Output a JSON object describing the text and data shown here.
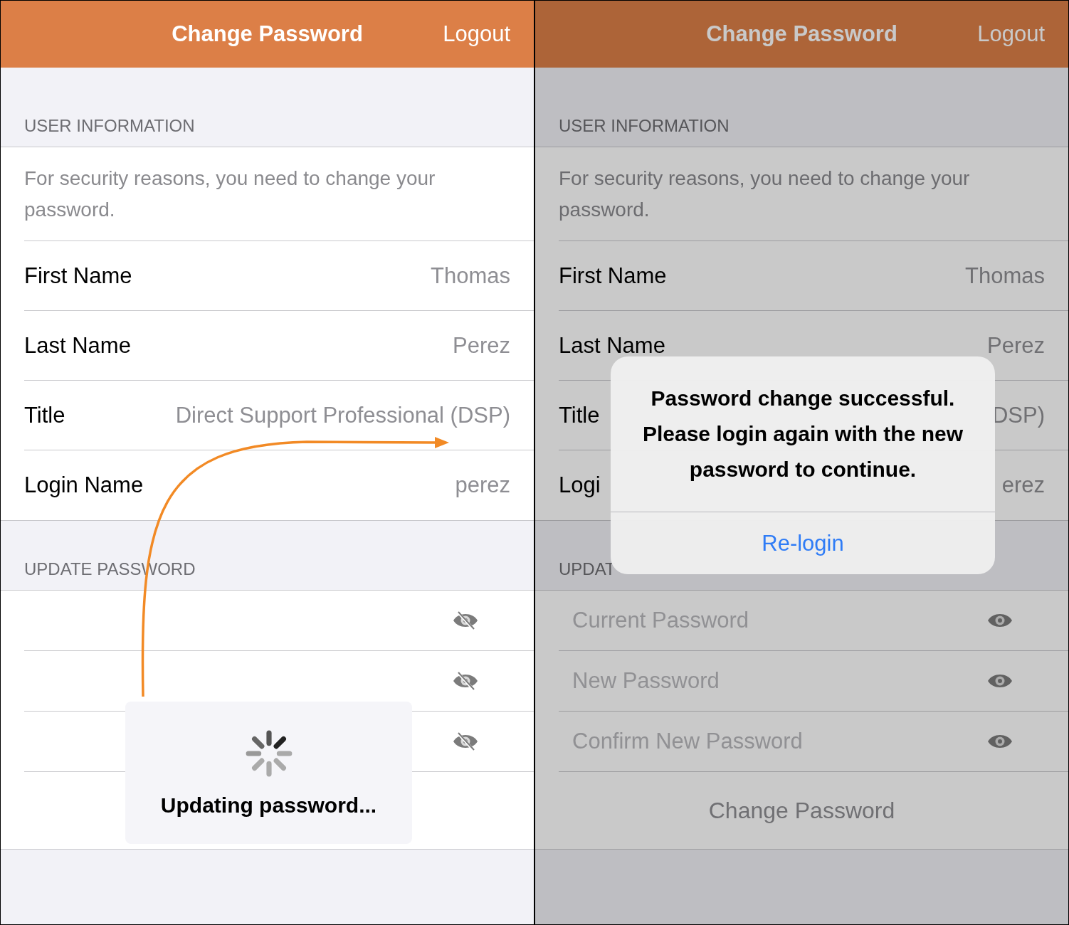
{
  "screens": [
    {
      "dimmed": false,
      "callout_arrow": true,
      "nav": {
        "title": "Change Password",
        "action": "Logout"
      },
      "user_section": {
        "header": "USER INFORMATION",
        "note": "For security reasons, you need to change your password.",
        "fields": [
          {
            "label": "First Name",
            "value": "Thomas"
          },
          {
            "label": "Last Name",
            "value": "Perez"
          },
          {
            "label": "Title",
            "value": "Direct Support Professional (DSP)"
          },
          {
            "label": "Login Name",
            "value": "perez"
          }
        ]
      },
      "password_section": {
        "header": "UPDATE PASSWORD",
        "fields": [
          {
            "visible": false
          },
          {
            "visible": false
          },
          {
            "visible": false
          }
        ]
      },
      "overlay": {
        "kind": "progress",
        "message": "Updating password..."
      }
    },
    {
      "dimmed": true,
      "callout_arrow": false,
      "nav": {
        "title": "Change Password",
        "action": "Logout"
      },
      "user_section": {
        "header": "USER INFORMATION",
        "note": "For security reasons, you need to change your password.",
        "fields": [
          {
            "label": "First Name",
            "value": "Thomas"
          },
          {
            "label": "Last Name",
            "value": "Perez"
          },
          {
            "label": "Title",
            "value": "DSP)"
          },
          {
            "label": "Logi",
            "value": "erez"
          }
        ]
      },
      "password_section": {
        "header": "UPDAT",
        "fields": [
          {
            "placeholder": "Current Password",
            "visible": true
          },
          {
            "placeholder": "New Password",
            "visible": true
          },
          {
            "placeholder": "Confirm New Password",
            "visible": true
          }
        ],
        "submit": "Change Password"
      },
      "overlay": {
        "kind": "alert",
        "message": "Password change successful. Please login again with the new password to continue.",
        "button": "Re-login"
      }
    }
  ]
}
